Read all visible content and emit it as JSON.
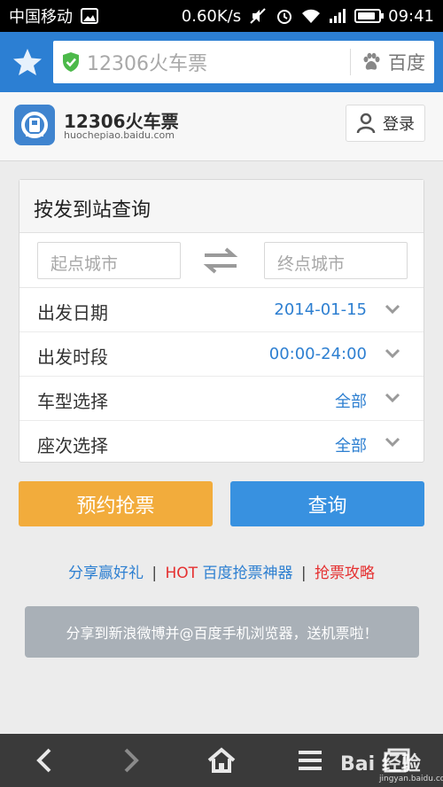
{
  "status_bar": {
    "carrier": "中国移动",
    "speed": "0.60K/s",
    "time": "09:41",
    "battery_level": 0.85,
    "icons": [
      "image-icon",
      "mute-icon",
      "alarm-icon",
      "wifi-icon",
      "signal-icon",
      "battery-icon"
    ]
  },
  "browser": {
    "address_text": "12306火车票",
    "search_engine": "百度",
    "icons": [
      "star-icon",
      "shield-check-icon",
      "paw-icon"
    ],
    "accent_color": "#2c7fd3"
  },
  "site": {
    "title": "12306火车票",
    "domain": "huochepiao.baidu.com",
    "login_label": "登录",
    "icons": [
      "railway-logo-icon",
      "user-icon"
    ]
  },
  "query_form": {
    "title": "按发到站查询",
    "from_placeholder": "起点城市",
    "to_placeholder": "终点城市",
    "options": [
      {
        "label": "出发日期",
        "value": "2014-01-15"
      },
      {
        "label": "出发时段",
        "value": "00:00-24:00"
      },
      {
        "label": "车型选择",
        "value": "全部"
      },
      {
        "label": "座次选择",
        "value": "全部"
      }
    ],
    "icons": [
      "swap-icon",
      "chevron-down-icon"
    ]
  },
  "buttons": {
    "reserve_label": "预约抢票",
    "query_label": "查询",
    "reserve_color": "#f2ac3c",
    "query_color": "#3891e0"
  },
  "links": {
    "share": "分享赢好礼",
    "sep": "|",
    "hot": "HOT",
    "tool": "百度抢票神器",
    "guide": "抢票攻略"
  },
  "toast": {
    "text": "分享到新浪微博并@百度手机浏览器，送机票啦！"
  },
  "bottom_nav": {
    "icons": [
      "back-icon",
      "forward-icon",
      "home-icon",
      "menu-icon",
      "tabs-icon"
    ]
  },
  "watermark": {
    "text": "Bai 经验",
    "sub": "jingyan.baidu.com"
  }
}
